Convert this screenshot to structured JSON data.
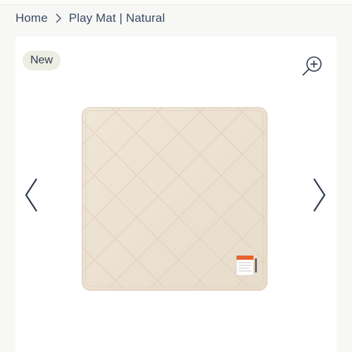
{
  "breadcrumb": {
    "home": "Home",
    "current": "Play Mat | Natural"
  },
  "product": {
    "badge": "New",
    "image_alt": "Play Mat | Natural"
  },
  "icons": {
    "separator": "chevron-right-icon",
    "zoom": "zoom-in-icon",
    "prev": "chevron-left-icon",
    "next": "chevron-right-icon"
  },
  "colors": {
    "text": "#3b4a63",
    "badge_bg": "#eceee3",
    "mat": "#ede2d3",
    "label_orange": "#e9622b"
  }
}
